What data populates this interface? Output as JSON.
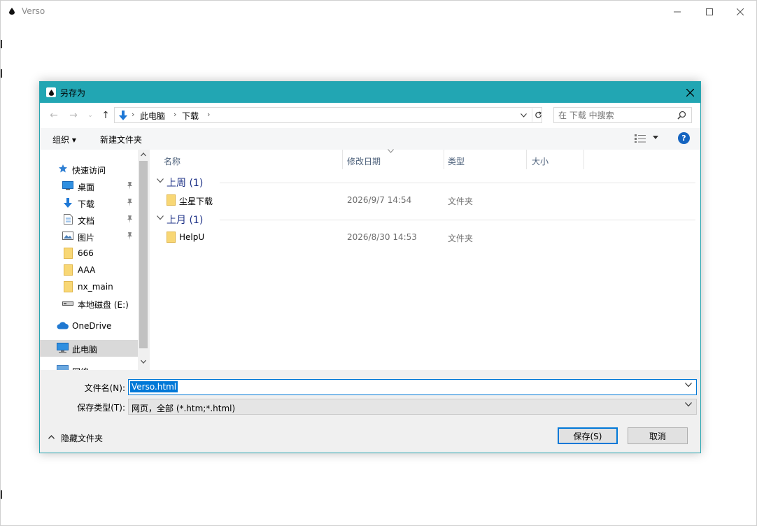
{
  "main_window": {
    "title": "Verso"
  },
  "dialog": {
    "title": "另存为",
    "address": {
      "crumbs": [
        "此电脑",
        "下载"
      ]
    },
    "search": {
      "placeholder": "在 下载 中搜索"
    },
    "toolbar": {
      "organize_label": "组织 ▾",
      "new_folder_label": "新建文件夹"
    },
    "nav_pane": {
      "items": [
        {
          "label": "快速访问",
          "icon": "star-icon"
        },
        {
          "label": "桌面",
          "icon": "desktop-icon",
          "pinned": true
        },
        {
          "label": "下载",
          "icon": "download-icon",
          "pinned": true
        },
        {
          "label": "文档",
          "icon": "document-icon",
          "pinned": true
        },
        {
          "label": "图片",
          "icon": "picture-icon",
          "pinned": true
        },
        {
          "label": "666",
          "icon": "folder-icon"
        },
        {
          "label": "AAA",
          "icon": "folder-icon"
        },
        {
          "label": "nx_main",
          "icon": "folder-icon"
        },
        {
          "label": "本地磁盘 (E:)",
          "icon": "drive-icon"
        },
        {
          "label": "OneDrive",
          "icon": "cloud-icon"
        },
        {
          "label": "此电脑",
          "icon": "computer-icon",
          "selected": true
        },
        {
          "label": "网络",
          "icon": "network-icon"
        }
      ]
    },
    "columns": {
      "name": "名称",
      "date": "修改日期",
      "type": "类型",
      "size": "大小"
    },
    "groups": [
      {
        "label": "上周 (1)",
        "files": [
          {
            "name": "尘星下载",
            "date": "2026/9/7 14:54",
            "type": "文件夹"
          }
        ]
      },
      {
        "label": "上月 (1)",
        "files": [
          {
            "name": "HelpU",
            "date": "2026/8/30 14:53",
            "type": "文件夹"
          }
        ]
      }
    ],
    "filename_label": "文件名(N):",
    "filename_value": "Verso.html",
    "filetype_label": "保存类型(T):",
    "filetype_value": "网页，全部 (*.htm;*.html)",
    "hide_folders_label": "隐藏文件夹",
    "save_label": "保存(S)",
    "cancel_label": "取消"
  },
  "colors": {
    "dialog_titlebar": "#22a6b3",
    "accent": "#0078d7",
    "group_header": "#1e3287",
    "folder": "#f8d775"
  }
}
